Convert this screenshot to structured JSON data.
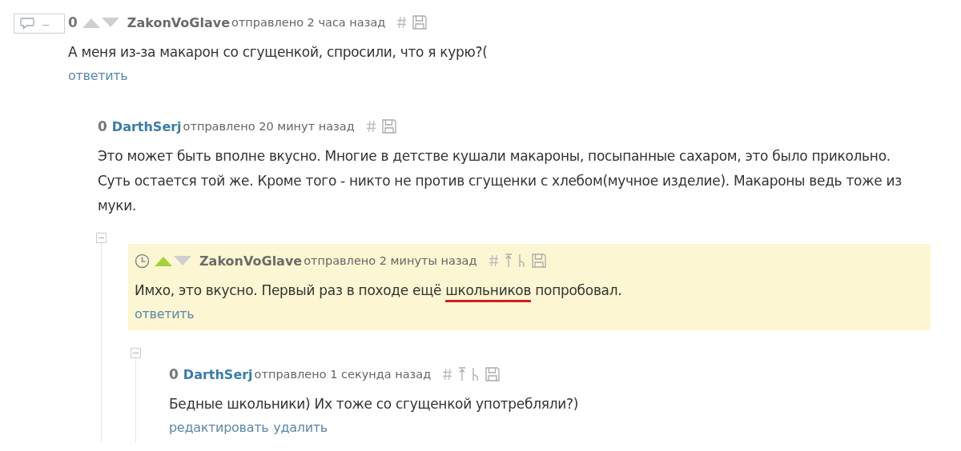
{
  "thread_controls": {
    "collapse_label": "–"
  },
  "comments": [
    {
      "score": "0",
      "arrows": [
        {
          "kind": "up",
          "selected": false
        },
        {
          "kind": "down",
          "selected": false
        }
      ],
      "author": "ZakonVoGlave",
      "own": false,
      "time": "отправлено 2 часа назад",
      "tools": [
        {
          "kind": "hash"
        },
        {
          "kind": "save"
        }
      ],
      "body": [
        {
          "text": "А меня из-за макарон со сгущенкой, спросили, что я курю?(",
          "underlined": false
        }
      ],
      "actions": [
        "ответить"
      ],
      "children": [
        {
          "score": "0",
          "author": "DarthSerj",
          "own": true,
          "time": "отправлено 20 минут назад",
          "tools": [
            {
              "kind": "hash"
            },
            {
              "kind": "save"
            }
          ],
          "body": [
            {
              "text": "Это может быть вполне вкусно. Многие в детстве кушали макароны, посыпанные сахаром, это было прикольно. Суть остается той же. Кроме того - никто не против сгущенки с хлебом(мучное изделие). Макароны ведь тоже из муки.",
              "underlined": false
            }
          ],
          "children": [
            {
              "expanded": true,
              "pending": true,
              "arrows": [
                {
                  "kind": "up",
                  "selected": true
                },
                {
                  "kind": "down",
                  "selected": false
                }
              ],
              "author": "ZakonVoGlave",
              "own": false,
              "time": "отправлено 2 минуты назад",
              "tools": [
                {
                  "kind": "hash"
                },
                {
                  "kind": "up"
                },
                {
                  "kind": "parent"
                },
                {
                  "kind": "save"
                }
              ],
              "highlighted": true,
              "body": [
                {
                  "text": "Имхо, это вкусно. Первый раз в походе ещё ",
                  "underlined": false
                },
                {
                  "text": "школьников",
                  "underlined": true
                },
                {
                  "text": " попробовал.",
                  "underlined": false
                }
              ],
              "actions": [
                "ответить"
              ],
              "children": [
                {
                  "expanded": true,
                  "score": "0",
                  "author": "DarthSerj",
                  "own": true,
                  "time": "отправлено 1 секунда назад",
                  "tools": [
                    {
                      "kind": "hash"
                    },
                    {
                      "kind": "up"
                    },
                    {
                      "kind": "parent"
                    },
                    {
                      "kind": "save"
                    }
                  ],
                  "body": [
                    {
                      "text": "Бедные школьники) Их тоже со сгущенкой употребляли?)",
                      "underlined": false
                    }
                  ],
                  "actions": [
                    "редактировать",
                    "удалить"
                  ]
                }
              ]
            }
          ]
        }
      ]
    }
  ]
}
